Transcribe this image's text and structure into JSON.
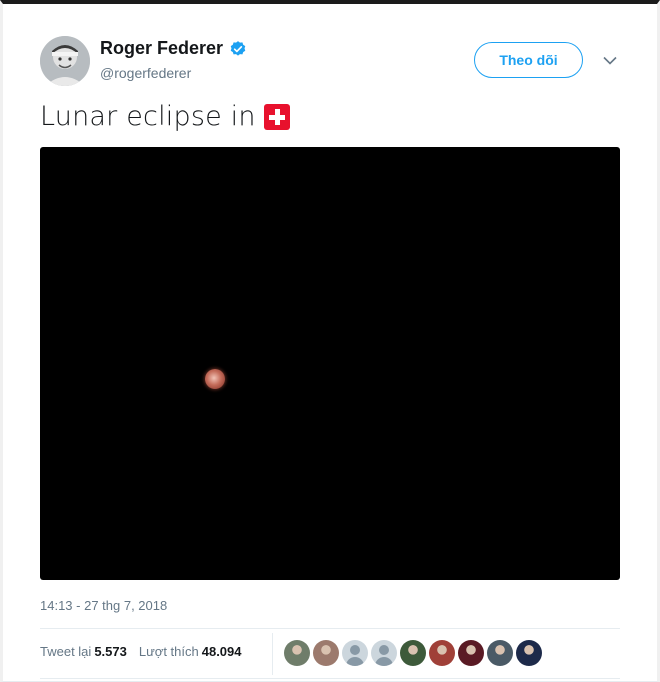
{
  "author": {
    "name": "Roger Federer",
    "handle": "@rogerfederer",
    "verified": true
  },
  "follow_button": {
    "label": "Theo dõi"
  },
  "tweet": {
    "text": "Lunar eclipse in",
    "emoji": "swiss-flag-emoji"
  },
  "media": {
    "type": "photo",
    "subject": "moon-icon"
  },
  "timestamp": "14:13 - 27 thg 7, 2018",
  "stats": {
    "retweets_label": "Tweet lại",
    "retweets_count": "5.573",
    "likes_label": "Lượt thích",
    "likes_count": "48.094"
  },
  "likers": [
    {
      "kind": "photo",
      "color": "#6f7d6a"
    },
    {
      "kind": "photo",
      "color": "#9c7a6d"
    },
    {
      "kind": "default"
    },
    {
      "kind": "default"
    },
    {
      "kind": "photo",
      "color": "#3d5a3a"
    },
    {
      "kind": "photo",
      "color": "#a04038"
    },
    {
      "kind": "photo",
      "color": "#5a1a24"
    },
    {
      "kind": "photo",
      "color": "#4a5a66"
    },
    {
      "kind": "photo",
      "color": "#1d2a4a"
    }
  ],
  "colors": {
    "accent": "#1da1f2",
    "secondary_text": "#657786",
    "primary_text": "#14171a",
    "divider": "#e6ecf0"
  }
}
